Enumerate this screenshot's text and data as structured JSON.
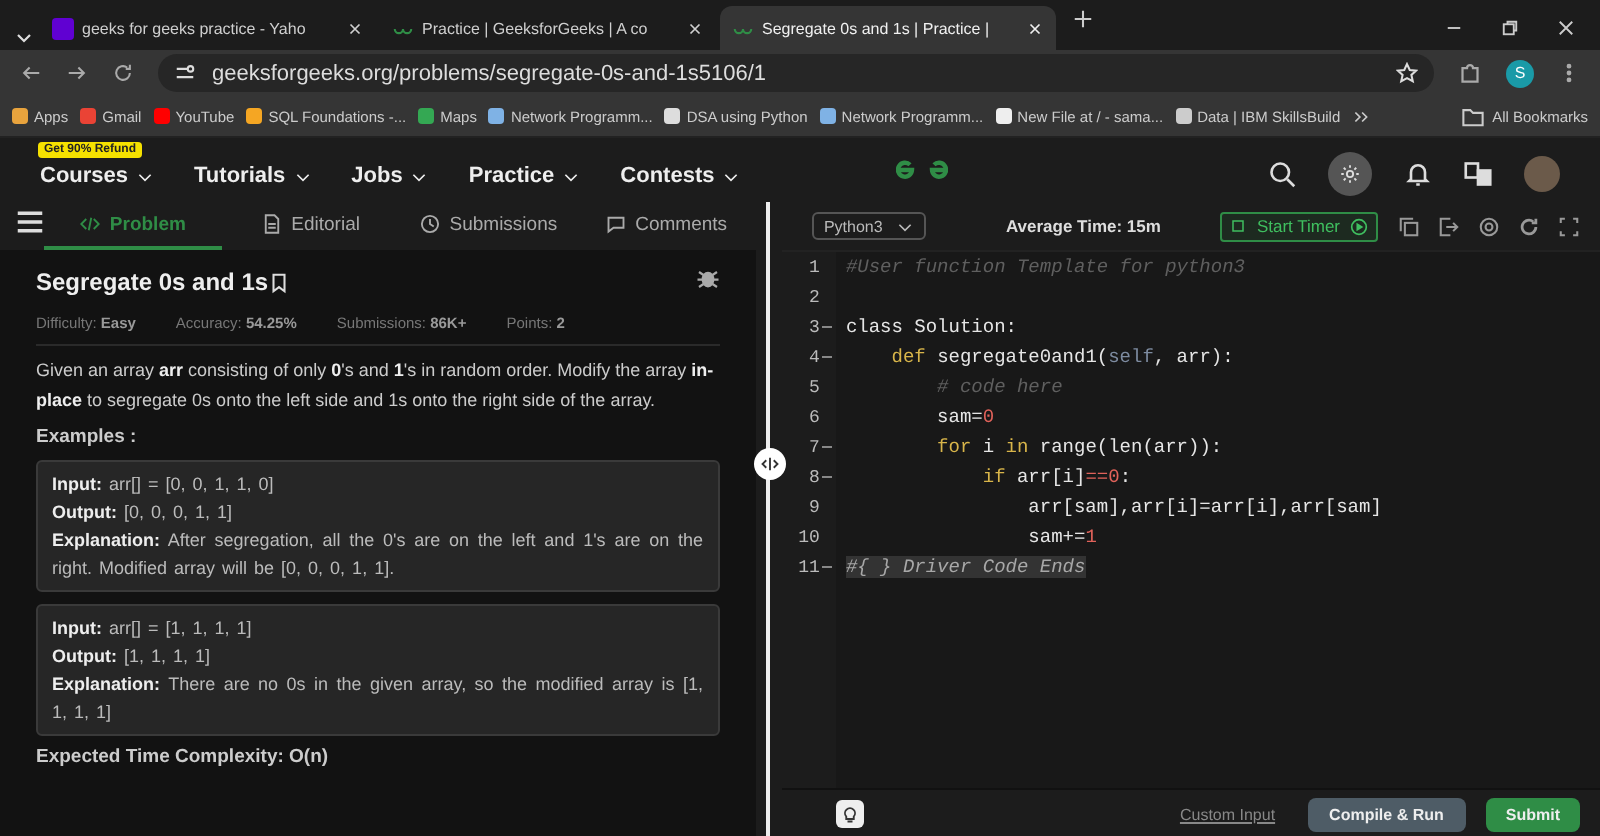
{
  "browser": {
    "tabs": [
      {
        "title": "geeks for geeks practice - Yaho",
        "selected": false,
        "kind": "yahoo"
      },
      {
        "title": "Practice | GeeksforGeeks | A co",
        "selected": false,
        "kind": "gfg"
      },
      {
        "title": "Segregate 0s and 1s | Practice |",
        "selected": true,
        "kind": "gfg"
      }
    ],
    "url": "geeksforgeeks.org/problems/segregate-0s-and-1s5106/1",
    "profile_initial": "S",
    "bookmarks": [
      {
        "label": "Apps",
        "color": "#e8a33d"
      },
      {
        "label": "Gmail",
        "color": "#ea4335"
      },
      {
        "label": "YouTube",
        "color": "#ff0000"
      },
      {
        "label": "SQL Foundations -...",
        "color": "#f5a623"
      },
      {
        "label": "Maps",
        "color": "#34a853"
      },
      {
        "label": "Network Programm...",
        "color": "#7fb2e5"
      },
      {
        "label": "DSA using Python",
        "color": "#dddddd"
      },
      {
        "label": "Network Programm...",
        "color": "#7fb2e5"
      },
      {
        "label": "New File at / - sama...",
        "color": "#eeeeee"
      },
      {
        "label": "Data | IBM SkillsBuild",
        "color": "#cccccc"
      }
    ],
    "all_bookmarks": "All Bookmarks"
  },
  "site_nav": {
    "promo_badge": "Get 90% Refund",
    "menus": [
      "Courses",
      "Tutorials",
      "Jobs",
      "Practice",
      "Contests"
    ]
  },
  "problem_tabs": [
    {
      "label": "Problem",
      "selected": true,
      "kind": "code"
    },
    {
      "label": "Editorial",
      "selected": false,
      "kind": "doc"
    },
    {
      "label": "Submissions",
      "selected": false,
      "kind": "clock"
    },
    {
      "label": "Comments",
      "selected": false,
      "kind": "chat"
    }
  ],
  "problem": {
    "title": "Segregate 0s and 1s",
    "meta": [
      {
        "label": "Difficulty:",
        "value": "Easy"
      },
      {
        "label": "Accuracy:",
        "value": "54.25%"
      },
      {
        "label": "Submissions:",
        "value": "86K+"
      },
      {
        "label": "Points:",
        "value": "2"
      }
    ],
    "statement": "Given an array **arr** consisting of only **0**'s and **1**'s in random order. Modify the array **in-place** to segregate 0s onto the left side and 1s onto the right side of the array.",
    "examples_heading": "Examples :",
    "examples": [
      {
        "lines": [
          "**Input:** arr[] = [0, 0, 1, 1, 0]",
          "**Output:** [0, 0, 0, 1, 1]",
          "**Explanation:**  After segregation, all the 0's are on the left and 1's are on the right. Modified array will be [0, 0, 0, 1, 1]."
        ]
      },
      {
        "lines": [
          "**Input:** arr[] = [1, 1, 1, 1]",
          "**Output:** [1, 1, 1, 1]",
          "**Explanation:** There are no 0s in the given array, so the modified array is [1, 1, 1, 1]"
        ]
      }
    ],
    "footer": "Expected Time Complexity: O(n)"
  },
  "editor": {
    "language": "Python3",
    "average_time": "Average Time: 15m",
    "start_timer": "Start Timer",
    "lines": [
      {
        "number": "1",
        "fold": false,
        "highlighted": false,
        "tokens": [
          {
            "kind": "comment",
            "text": "#User function Template for python3"
          }
        ]
      },
      {
        "number": "2",
        "fold": false,
        "highlighted": false
      },
      {
        "number": "3",
        "fold": true,
        "highlighted": false,
        "tokens": [
          {
            "kind": "plain",
            "text": "class Solution:"
          }
        ]
      },
      {
        "number": "4",
        "fold": true,
        "highlighted": false,
        "tokens": [
          {
            "kind": "keyword",
            "text": "    def"
          },
          {
            "kind": "plain",
            "text": " segregate0and1("
          },
          {
            "kind": "self",
            "text": "self"
          },
          {
            "kind": "plain",
            "text": ", arr):"
          }
        ]
      },
      {
        "number": "5",
        "fold": false,
        "highlighted": false,
        "tokens": [
          {
            "kind": "comment",
            "text": "        # code here"
          }
        ]
      },
      {
        "number": "6",
        "fold": false,
        "highlighted": false,
        "tokens": [
          {
            "kind": "plain",
            "text": "        sam="
          },
          {
            "kind": "number",
            "text": "0"
          }
        ]
      },
      {
        "number": "7",
        "fold": true,
        "highlighted": false,
        "tokens": [
          {
            "kind": "keyword",
            "text": "        for"
          },
          {
            "kind": "plain",
            "text": " i "
          },
          {
            "kind": "keyword",
            "text": "in"
          },
          {
            "kind": "plain",
            "text": " range(len(arr)):"
          }
        ]
      },
      {
        "number": "8",
        "fold": true,
        "highlighted": false,
        "tokens": [
          {
            "kind": "keyword",
            "text": "            if"
          },
          {
            "kind": "plain",
            "text": " arr[i]"
          },
          {
            "kind": "number",
            "text": "==0"
          },
          {
            "kind": "plain",
            "text": ":"
          }
        ]
      },
      {
        "number": "9",
        "fold": false,
        "highlighted": false,
        "tokens": [
          {
            "kind": "plain",
            "text": "                arr[sam],arr[i]=arr[i],arr[sam]"
          }
        ]
      },
      {
        "number": "10",
        "fold": false,
        "highlighted": false,
        "tokens": [
          {
            "kind": "plain",
            "text": "                sam+="
          },
          {
            "kind": "number",
            "text": "1"
          }
        ]
      },
      {
        "number": "11",
        "fold": true,
        "highlighted": true,
        "tokens": [
          {
            "kind": "comment",
            "text": "#{ } Driver Code Ends"
          }
        ]
      }
    ],
    "custom_input": "Custom Input",
    "compile_run": "Compile & Run",
    "submit": "Submit"
  }
}
